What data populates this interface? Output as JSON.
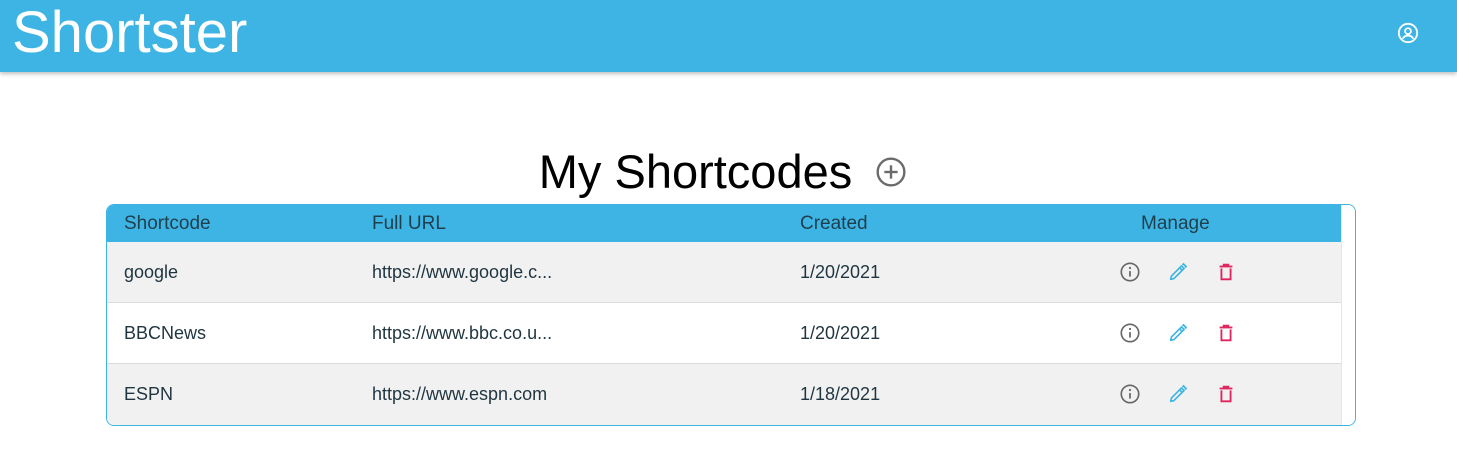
{
  "app": {
    "brand": "Shortster"
  },
  "page": {
    "title": "My Shortcodes"
  },
  "table": {
    "headers": {
      "shortcode": "Shortcode",
      "full_url": "Full URL",
      "created": "Created",
      "manage": "Manage"
    },
    "rows": [
      {
        "shortcode": "google",
        "full_url": "https://www.google.c...",
        "created": "1/20/2021"
      },
      {
        "shortcode": "BBCNews",
        "full_url": "https://www.bbc.co.u...",
        "created": "1/20/2021"
      },
      {
        "shortcode": "ESPN",
        "full_url": "https://www.espn.com",
        "created": "1/18/2021"
      }
    ]
  },
  "icons": {
    "account": "account-circle-icon",
    "add": "add-circle-icon",
    "info": "info-icon",
    "edit": "pencil-icon",
    "delete": "trash-icon"
  },
  "colors": {
    "primary": "#3db4e3",
    "info": "#666666",
    "edit": "#3db4e3",
    "delete": "#e0245e"
  }
}
